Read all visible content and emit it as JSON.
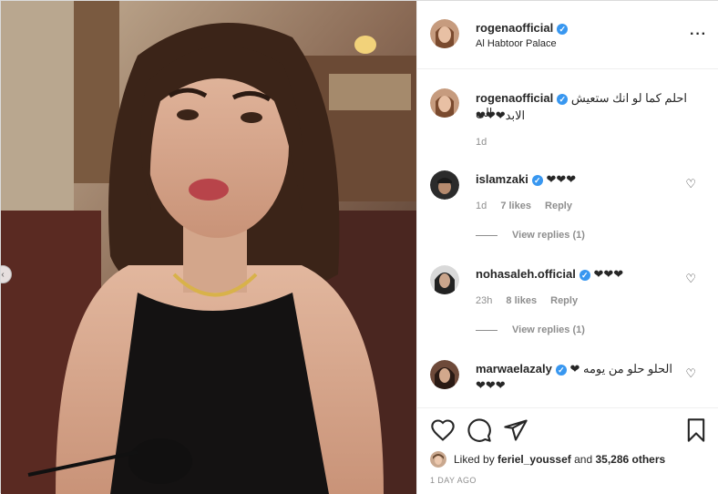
{
  "post": {
    "author": "rogenaofficial",
    "location": "Al Habtoor Palace",
    "more_icon": "more-dots-icon",
    "caption": {
      "username": "rogenaofficial",
      "text_line1": "احلم كما لو انك ستعيش الى",
      "text_line2": "الابد❤❤❤",
      "time": "1d"
    }
  },
  "comments": [
    {
      "username": "islamzaki",
      "text": "❤❤❤",
      "time": "1d",
      "likes": "7 likes",
      "reply": "Reply",
      "view_replies": "View replies (1)"
    },
    {
      "username": "nohasaleh.official",
      "text": "❤❤❤",
      "time": "23h",
      "likes": "8 likes",
      "reply": "Reply",
      "view_replies": "View replies (1)"
    },
    {
      "username": "marwaelazaly",
      "text_line1": "الحلو حلو من يومه ❤",
      "text_line2": "❤❤❤"
    }
  ],
  "footer": {
    "liked_prefix": "Liked by",
    "liked_user": "feriel_youssef",
    "liked_and": "and",
    "liked_others": "35,286 others",
    "timestamp": "1 DAY AGO"
  },
  "icons": {
    "like": "heart-outline-icon",
    "comment": "comment-bubble-icon",
    "share": "paper-plane-icon",
    "save": "bookmark-icon"
  },
  "colors": {
    "verified": "#3897f0",
    "text": "#262626",
    "muted": "#8e8e8e",
    "border": "#efefef"
  }
}
